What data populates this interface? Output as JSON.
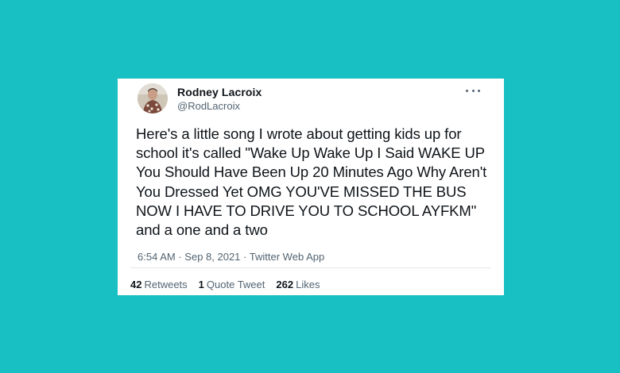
{
  "background_color": "#18bfc3",
  "tweet": {
    "author": {
      "display_name": "Rodney Lacroix",
      "handle": "@RodLacroix"
    },
    "more_icon": "more-horizontal-icon",
    "text": "Here's a little song I wrote about getting kids up for school it's called \"Wake Up Wake Up I Said WAKE UP You Should Have Been Up 20 Minutes Ago Why Aren't You Dressed Yet OMG YOU'VE MISSED THE BUS NOW I HAVE TO DRIVE YOU TO SCHOOL AYFKM\" and a one and a two",
    "time": "6:54 AM",
    "separator": "·",
    "date": "Sep 8, 2021",
    "source": "Twitter Web App",
    "stats": {
      "retweets_count": "42",
      "retweets_label": "Retweets",
      "quote_count": "1",
      "quote_label": "Quote Tweet",
      "likes_count": "262",
      "likes_label": "Likes"
    }
  }
}
